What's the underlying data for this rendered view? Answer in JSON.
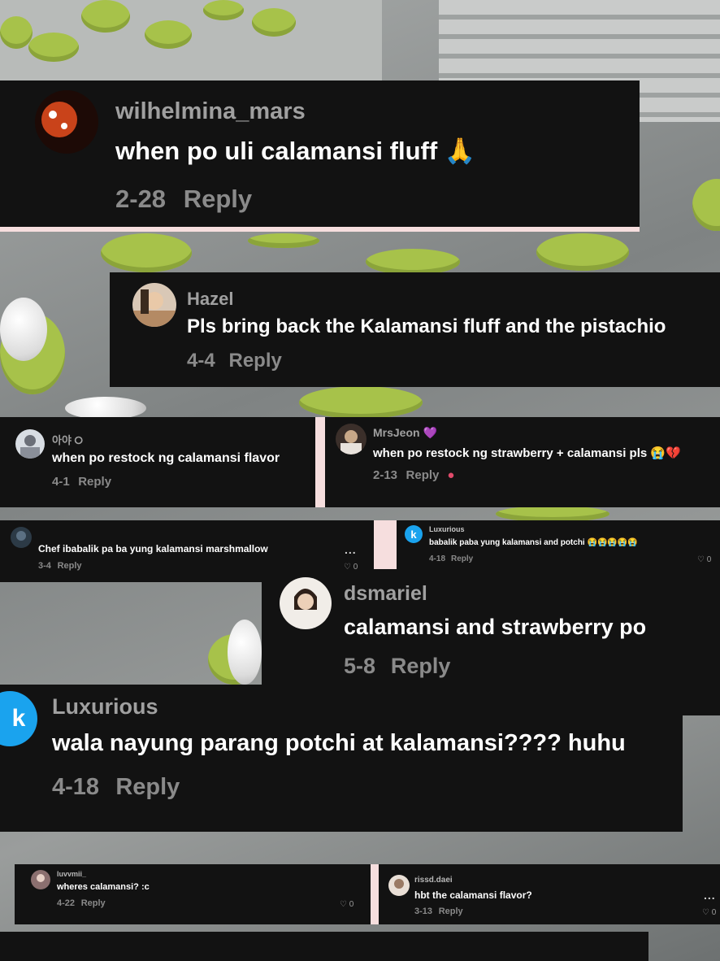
{
  "comments": [
    {
      "name": "wilhelmina_mars",
      "text": "when po uli calamansi fluff 🙏",
      "date": "2-28",
      "reply": "Reply"
    },
    {
      "name": "Hazel",
      "text": "Pls bring back the Kalamansi fluff and the pistachio",
      "date": "4-4",
      "reply": "Reply"
    },
    {
      "name": "아야 ⭘",
      "text": "when po restock ng calamansi flavor",
      "date": "4-1",
      "reply": "Reply"
    },
    {
      "name": "MrsJeon 💜",
      "text": "when po restock ng strawberry + calamansi pls 😭💔",
      "date": "2-13",
      "reply": "Reply"
    },
    {
      "name": "",
      "text": "Chef ibabalik pa ba yung kalamansi marshmallow",
      "date": "3-4",
      "reply": "Reply",
      "likes": "♡ 0"
    },
    {
      "name": "Luxurious",
      "text": "babalik paba yung kalamansi and potchi 😭😭😭😭😭",
      "date": "4-18",
      "reply": "Reply",
      "likes": "♡ 0",
      "avatar": "k"
    },
    {
      "name": "dsmariel",
      "text": "calamansi and strawberry po",
      "date": "5-8",
      "reply": "Reply"
    },
    {
      "name": "Luxurious",
      "text": "wala nayung parang potchi at kalamansi???? huhu",
      "date": "4-18",
      "reply": "Reply",
      "avatar": "k"
    },
    {
      "name": "luvvmii_",
      "text": "wheres calamansi? :c",
      "date": "4-22",
      "reply": "Reply",
      "likes": "♡ 0"
    },
    {
      "name": "rissd.daei",
      "text": "hbt the calamansi flavor?",
      "date": "3-13",
      "reply": "Reply",
      "likes": "♡ 0"
    }
  ],
  "more_dots": "...",
  "colors": {
    "card": "#121212",
    "name": "#a0a0a0",
    "meta": "#8a8a8a",
    "accent_avatar": "#1aa3ee"
  }
}
